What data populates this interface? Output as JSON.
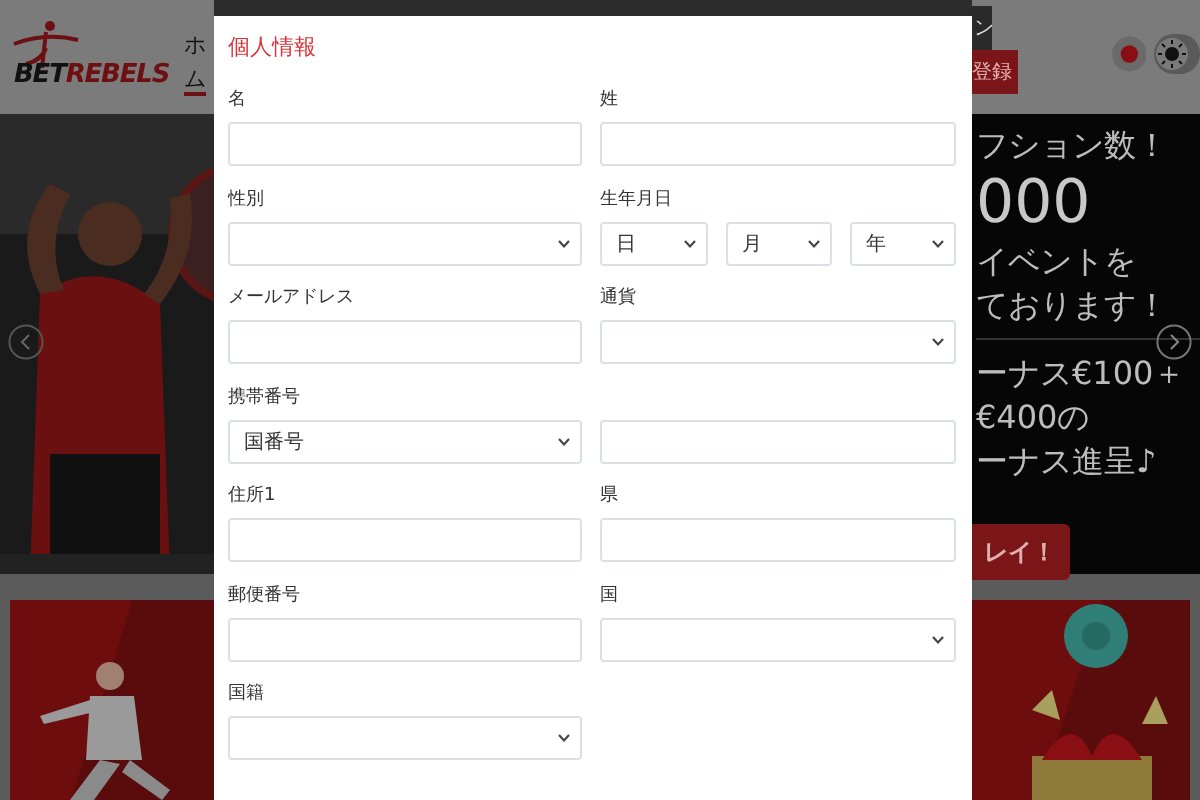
{
  "header": {
    "logo": [
      "BET",
      "REBELS"
    ],
    "nav": [
      "ホ",
      "ム"
    ],
    "buttons": [
      {
        "label": "ン",
        "kind": "dark"
      },
      {
        "label": "登録",
        "kind": "primary"
      }
    ]
  },
  "hero": {
    "lines": [
      {
        "text": "フション数！",
        "kind": "normal"
      },
      {
        "text": "000",
        "kind": "big"
      },
      {
        "text": "イベントを",
        "kind": "normal"
      },
      {
        "text": "ております！",
        "kind": "normal"
      },
      {
        "text": "ーナス€100＋",
        "kind": "normal"
      },
      {
        "text": "€400の",
        "kind": "normal"
      },
      {
        "text": "ーナス進呈♪",
        "kind": "normal"
      }
    ],
    "cta": "レイ！"
  },
  "modal": {
    "title": "個人情報",
    "fields": [
      {
        "label": "名",
        "kind": "text"
      },
      {
        "label": "姓",
        "kind": "text"
      },
      {
        "label": "性別",
        "kind": "select"
      },
      {
        "label": "生年月日",
        "kind": "date",
        "parts": [
          "日",
          "月",
          "年"
        ]
      },
      {
        "label": "メールアドレス",
        "kind": "text"
      },
      {
        "label": "通貨",
        "kind": "select"
      },
      {
        "label": "携帯番号",
        "kind": "phone",
        "code": "国番号"
      },
      {
        "label": "住所1",
        "kind": "text"
      },
      {
        "label": "県",
        "kind": "text"
      },
      {
        "label": "郵便番号",
        "kind": "text"
      },
      {
        "label": "国",
        "kind": "select"
      },
      {
        "label": "国籍",
        "kind": "select"
      }
    ]
  }
}
